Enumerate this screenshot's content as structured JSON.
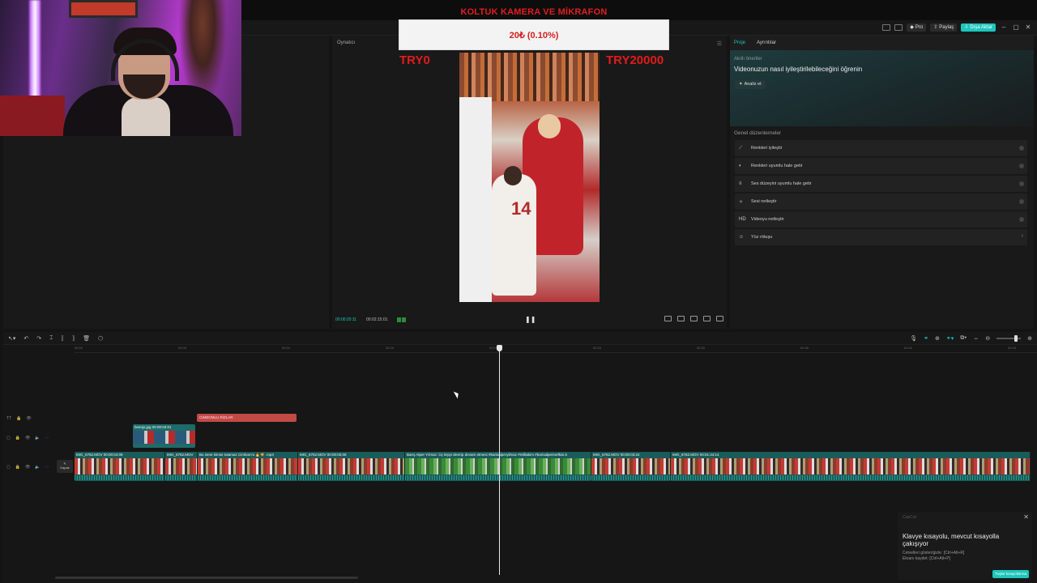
{
  "banner": {
    "title": "KOLTUK KAMERA VE MİKRAFON",
    "value": "20₺ (0.10%)",
    "left": "TRY0",
    "right": "TRY20000"
  },
  "header": {
    "pro": "Pro",
    "share": "Paylaş",
    "export": "Dışa Aktar"
  },
  "player": {
    "title": "Oynatıcı",
    "time_current": "00:00:20:11",
    "time_total": "00:02:15:01"
  },
  "right_panel": {
    "tabs": [
      "Proje",
      "Ayrıntılar"
    ],
    "ai_label": "Akıllı öneriler",
    "ai_title": "Videonuzun nasıl iyileştirilebileceğini öğrenin",
    "analyze": "Analiz et",
    "general_label": "Genel düzenlemeler",
    "items": [
      {
        "label": "Renkleri iyileştir",
        "icon": "wand-icon"
      },
      {
        "label": "Renkleri uyumlu hale getir",
        "icon": "color-match-icon"
      },
      {
        "label": "Ses düzeyini uyumlu hale getir",
        "icon": "sliders-icon"
      },
      {
        "label": "Sesi netleştir",
        "icon": "sparkle-icon"
      },
      {
        "label": "Videoyu netleştir",
        "icon": "hd-icon"
      },
      {
        "label": "Yüz rötuşu",
        "icon": "face-icon"
      }
    ]
  },
  "timeline": {
    "ruler": [
      "00:00",
      "00:05",
      "00:10",
      "00:15",
      "00:20",
      "00:25",
      "00:30",
      "00:35",
      "00:40",
      "00:45"
    ],
    "cover": "Kapak",
    "text_clip": "CİMBOMLU RİZLAR",
    "image_clip": "beenjs.jpg  00:00:03:01",
    "main_clips": [
      {
        "label": "IMG_6762.MOV  00:00:04:09",
        "style": "red"
      },
      {
        "label": "IMG_6762.MOV",
        "style": "red"
      },
      {
        "label": "Bu sene kimse tutamaz Cimbom'u 🔥🦁 .mp4",
        "style": "red"
      },
      {
        "label": "IMG_6762.MOV  00:00:05:05",
        "style": "red"
      },
      {
        "label": "Barış Alper Yılmaz: Üç kişiyi devirip devam etmesi #barisalperyilmaz #milliakim #barisalperinefkisi.b",
        "style": "green"
      },
      {
        "label": "IMG_6762.MOV  00:00:03:24",
        "style": "red"
      },
      {
        "label": "IMG_6762.MOV  00:01:44:14",
        "style": "red"
      }
    ]
  },
  "toast": {
    "app": "CapCut",
    "title": "Klavye kısayolu, mevcut kısayolla çakışıyor",
    "line1": "Cetvelleri göster/gizle: [Ctrl+Alt+R]",
    "line2": "Ekranı kaydet: [Ctrl+Alt+P]",
    "button": "Tuşlar kısayollarına"
  },
  "colors": {
    "accent": "#1fc6bd",
    "banner_red": "#e21d1d"
  }
}
